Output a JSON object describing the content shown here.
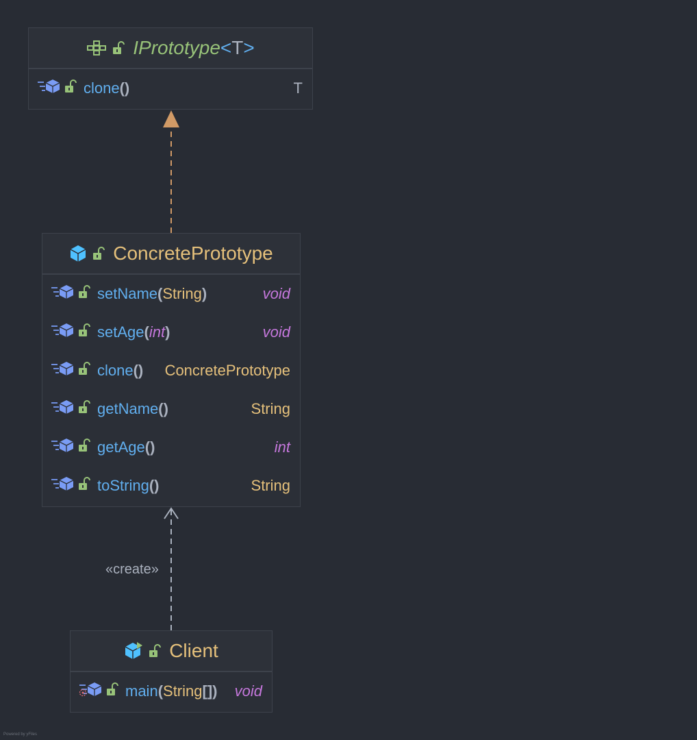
{
  "diagram": {
    "nodes": {
      "prototype": {
        "kind": "interface",
        "name": "IPrototype",
        "generic_open": "<",
        "generic_param": "T",
        "generic_close": ">",
        "methods": [
          {
            "name": "clone",
            "params": [],
            "return": "T",
            "return_kind": "generic"
          }
        ]
      },
      "concrete": {
        "kind": "class",
        "name": "ConcretePrototype",
        "methods": [
          {
            "name": "setName",
            "params": [
              {
                "type": "String",
                "kind": "ref"
              }
            ],
            "return": "void",
            "return_kind": "prim"
          },
          {
            "name": "setAge",
            "params": [
              {
                "type": "int",
                "kind": "prim"
              }
            ],
            "return": "void",
            "return_kind": "prim"
          },
          {
            "name": "clone",
            "params": [],
            "return": "ConcretePrototype",
            "return_kind": "ref"
          },
          {
            "name": "getName",
            "params": [],
            "return": "String",
            "return_kind": "ref"
          },
          {
            "name": "getAge",
            "params": [],
            "return": "int",
            "return_kind": "prim"
          },
          {
            "name": "toString",
            "params": [],
            "return": "String",
            "return_kind": "ref"
          }
        ]
      },
      "client": {
        "kind": "class",
        "name": "Client",
        "methods": [
          {
            "name": "main",
            "params": [
              {
                "type": "String",
                "kind": "ref",
                "array": true
              }
            ],
            "return": "void",
            "return_kind": "prim",
            "is_static": true
          }
        ]
      }
    },
    "edges": [
      {
        "from": "concrete",
        "to": "prototype",
        "kind": "realization"
      },
      {
        "from": "client",
        "to": "concrete",
        "kind": "dependency",
        "label": "«create»"
      }
    ],
    "footer": "Powered by yFiles"
  },
  "colors": {
    "background": "#282c34",
    "method": "#61afef",
    "reference_type": "#e5c07b",
    "primitive_type": "#c678dd",
    "interface": "#98c379",
    "lock": "#98c379",
    "realization_edge": "#d19a66",
    "dependency_edge": "#abb2bf"
  },
  "icons": {
    "interface_header": [
      "interface-icon",
      "lock-open-icon"
    ],
    "class_header": [
      "class-cube-icon",
      "lock-open-icon"
    ],
    "client_header": [
      "runnable-class-icon",
      "lock-open-icon"
    ],
    "method_row": [
      "method-icon",
      "lock-open-icon"
    ],
    "static_method_row": [
      "static-method-icon",
      "lock-open-icon"
    ]
  }
}
